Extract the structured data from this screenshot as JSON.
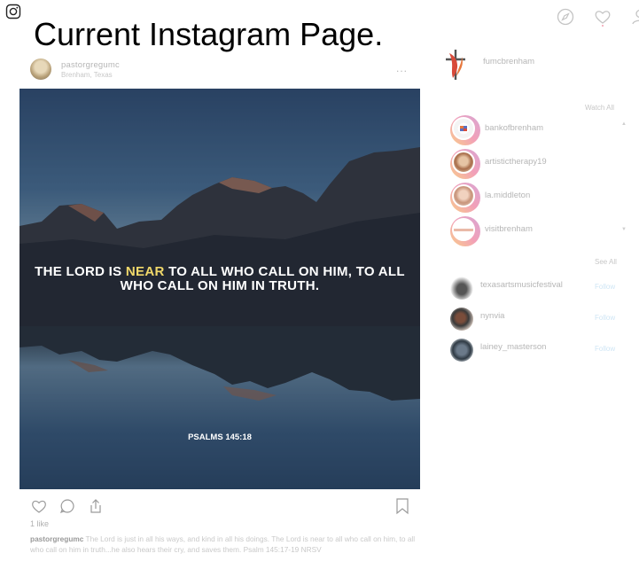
{
  "header": {
    "title": "Current Instagram Page.",
    "icons": [
      "instagram-logo-icon",
      "compass-icon",
      "heart-icon",
      "profile-icon"
    ]
  },
  "post": {
    "username": "pastorgregumc",
    "location": "Brenham, Texas",
    "more": "...",
    "verse_before": "THE LORD IS ",
    "verse_highlight": "NEAR",
    "verse_after": " TO ALL WHO CALL ON HIM, TO ALL WHO CALL ON HIM IN TRUTH.",
    "verse_reference": "PSALMS 145:18",
    "likes": "1 like",
    "caption_user": "pastorgregumc",
    "caption_text": " The Lord is just in all his ways, and kind in all his doings. The Lord is near to all who call on him, to all who call on him in truth...he also hears their cry, and saves them. Psalm 145:17-19 NRSV",
    "highlight_color": "#f0d86a"
  },
  "sidebar": {
    "user": {
      "username": "fumcbrenham"
    },
    "stories": {
      "watch_all": "Watch All",
      "items": [
        {
          "username": "bankofbrenham"
        },
        {
          "username": "artistictherapy19"
        },
        {
          "username": "la.middleton"
        },
        {
          "username": "visitbrenham"
        }
      ]
    },
    "suggestions": {
      "see_all": "See All",
      "items": [
        {
          "username": "texasartsmusicfestival",
          "action": "Follow"
        },
        {
          "username": "nynvia",
          "action": "Follow"
        },
        {
          "username": "lainey_masterson",
          "action": "Follow"
        }
      ]
    }
  }
}
